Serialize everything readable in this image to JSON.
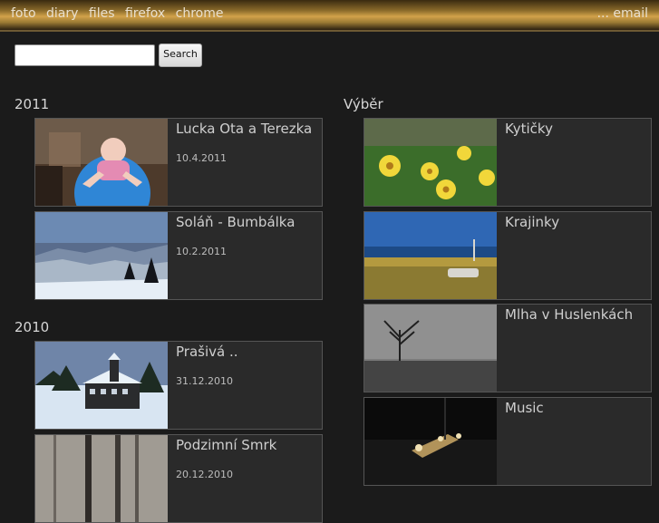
{
  "nav": {
    "links": [
      "foto",
      "diary",
      "files",
      "firefox",
      "chrome"
    ],
    "right_link": "... email"
  },
  "search": {
    "button": "Search",
    "placeholder": ""
  },
  "left": {
    "sections": [
      {
        "year": "2011",
        "items": [
          {
            "title": "Lucka Ota a Terezka",
            "date": "10.4.2011"
          },
          {
            "title": "Soláň - Bumbálka",
            "date": "10.2.2011"
          }
        ]
      },
      {
        "year": "2010",
        "items": [
          {
            "title": "Prašivá ..",
            "date": "31.12.2010"
          },
          {
            "title": "Podzimní Smrk",
            "date": "20.12.2010"
          }
        ]
      }
    ]
  },
  "right": {
    "title": "Výběr",
    "items": [
      "Kytičky",
      "Krajinky",
      "Mlha v Huslenkách",
      "Music"
    ]
  }
}
